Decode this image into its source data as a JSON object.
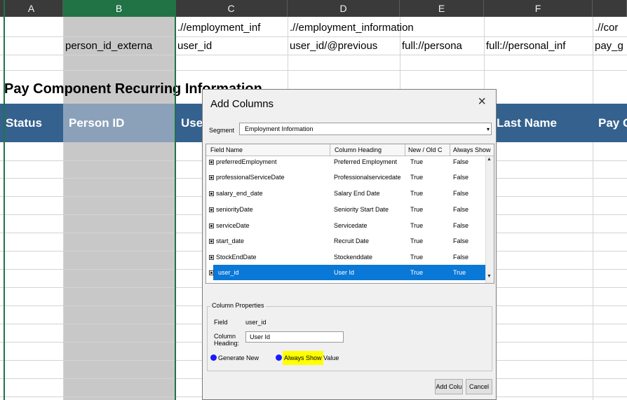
{
  "sheet": {
    "columns": [
      "A",
      "B",
      "C",
      "D",
      "E",
      "F",
      ""
    ],
    "row1": {
      "C": ".//employment_inf",
      "D": ".//employment_information",
      "G": ".//cor"
    },
    "row2": {
      "B": "person_id_externa",
      "C": "user_id",
      "D": "user_id/@previous",
      "E": "full://persona",
      "F": "full://personal_inf",
      "G": "pay_g"
    },
    "title": "Pay Component Recurring Information",
    "headers": {
      "A": "Status",
      "B": "Person ID",
      "C": "Use",
      "F": "Last Name",
      "G": "Pay G"
    }
  },
  "dialog": {
    "title": "Add Columns",
    "close_icon": "×",
    "segment_label": "Segment",
    "segment_value": "Employment Information",
    "grid_headers": [
      "Field Name",
      "Column Heading",
      "New / Old C",
      "Always Show"
    ],
    "rows": [
      {
        "field": "preferredEmployment",
        "heading": "Preferred Employment",
        "new": "True",
        "always": "False"
      },
      {
        "field": "professionalServiceDate",
        "heading": "Professionalservicedate",
        "new": "True",
        "always": "False"
      },
      {
        "field": "salary_end_date",
        "heading": "Salary End Date",
        "new": "True",
        "always": "False"
      },
      {
        "field": "seniorityDate",
        "heading": "Seniority Start Date",
        "new": "True",
        "always": "False"
      },
      {
        "field": "serviceDate",
        "heading": "Servicedate",
        "new": "True",
        "always": "False"
      },
      {
        "field": "start_date",
        "heading": "Recruit Date",
        "new": "True",
        "always": "False"
      },
      {
        "field": "StockEndDate",
        "heading": "Stockenddate",
        "new": "True",
        "always": "False"
      },
      {
        "field": "user_id",
        "heading": "User Id",
        "new": "True",
        "always": "True"
      }
    ],
    "props_title": "Column Properties",
    "field_label": "Field",
    "field_value": "user_id",
    "col_heading_label": "Column Heading:",
    "col_heading_value": "User Id",
    "generate_new": "Generate New",
    "always_show": "Always Show",
    "value_label": "Value",
    "add_button": "Add Colu",
    "cancel_button": "Cancel"
  }
}
